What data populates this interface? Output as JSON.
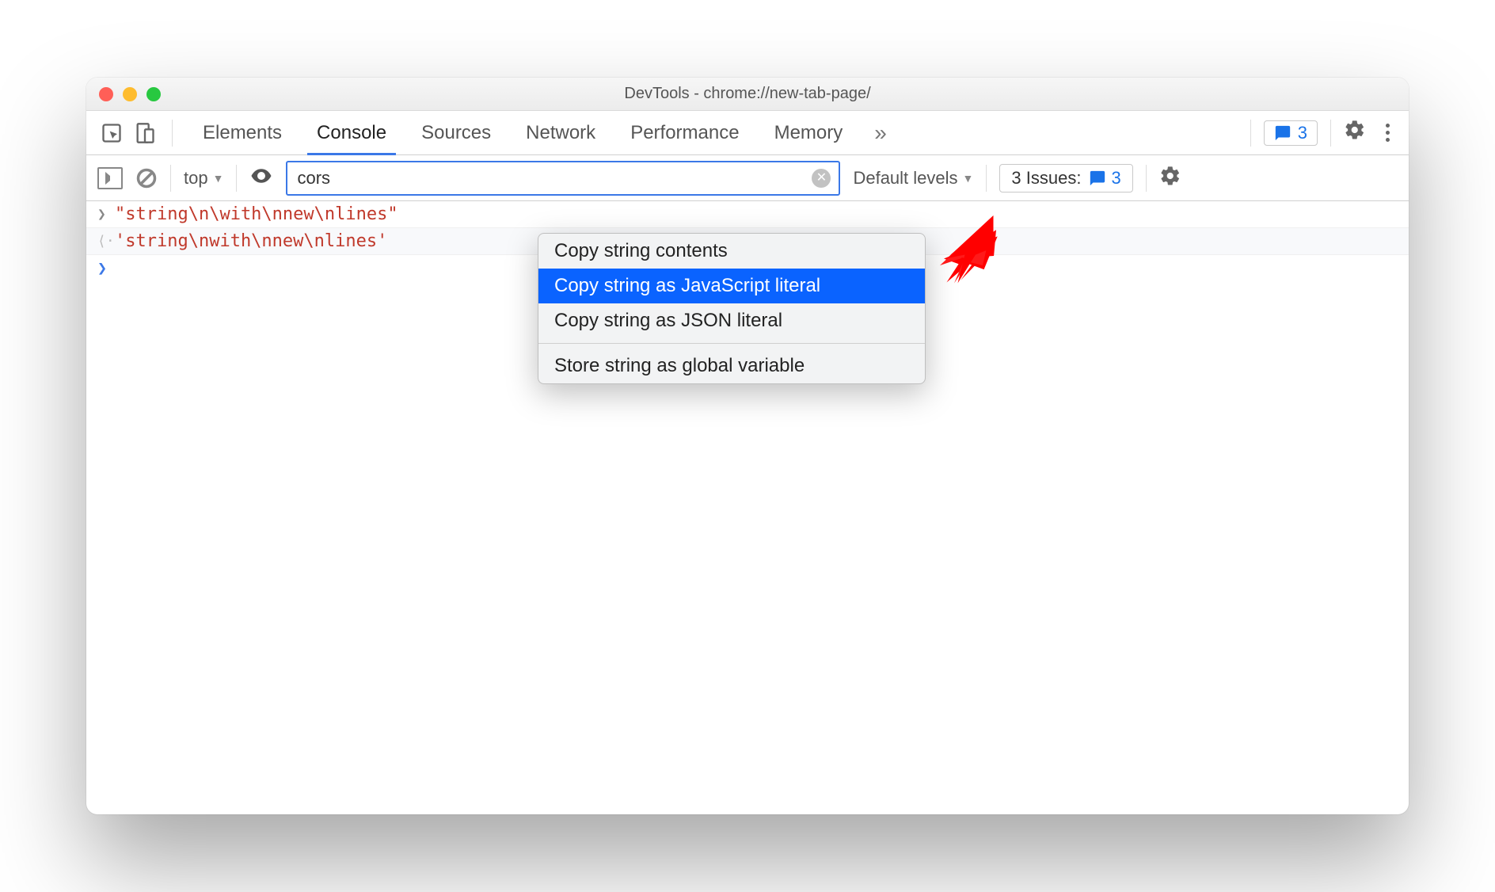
{
  "window": {
    "title": "DevTools - chrome://new-tab-page/"
  },
  "tabbar": {
    "tabs": [
      "Elements",
      "Console",
      "Sources",
      "Network",
      "Performance",
      "Memory"
    ],
    "active_index": 1,
    "more_icon": "»",
    "badge_count": "3"
  },
  "filterbar": {
    "context": "top",
    "filter_value": "cors",
    "levels_label": "Default levels",
    "issues_label": "3 Issues:",
    "issues_count": "3"
  },
  "console": {
    "rows": [
      {
        "kind": "input",
        "text": "\"string\\n\\with\\nnew\\nlines\""
      },
      {
        "kind": "output",
        "text": "'string\\nwith\\nnew\\nlines'"
      }
    ]
  },
  "context_menu": {
    "items": [
      "Copy string contents",
      "Copy string as JavaScript literal",
      "Copy string as JSON literal"
    ],
    "selected_index": 1,
    "items2": [
      "Store string as global variable"
    ]
  }
}
